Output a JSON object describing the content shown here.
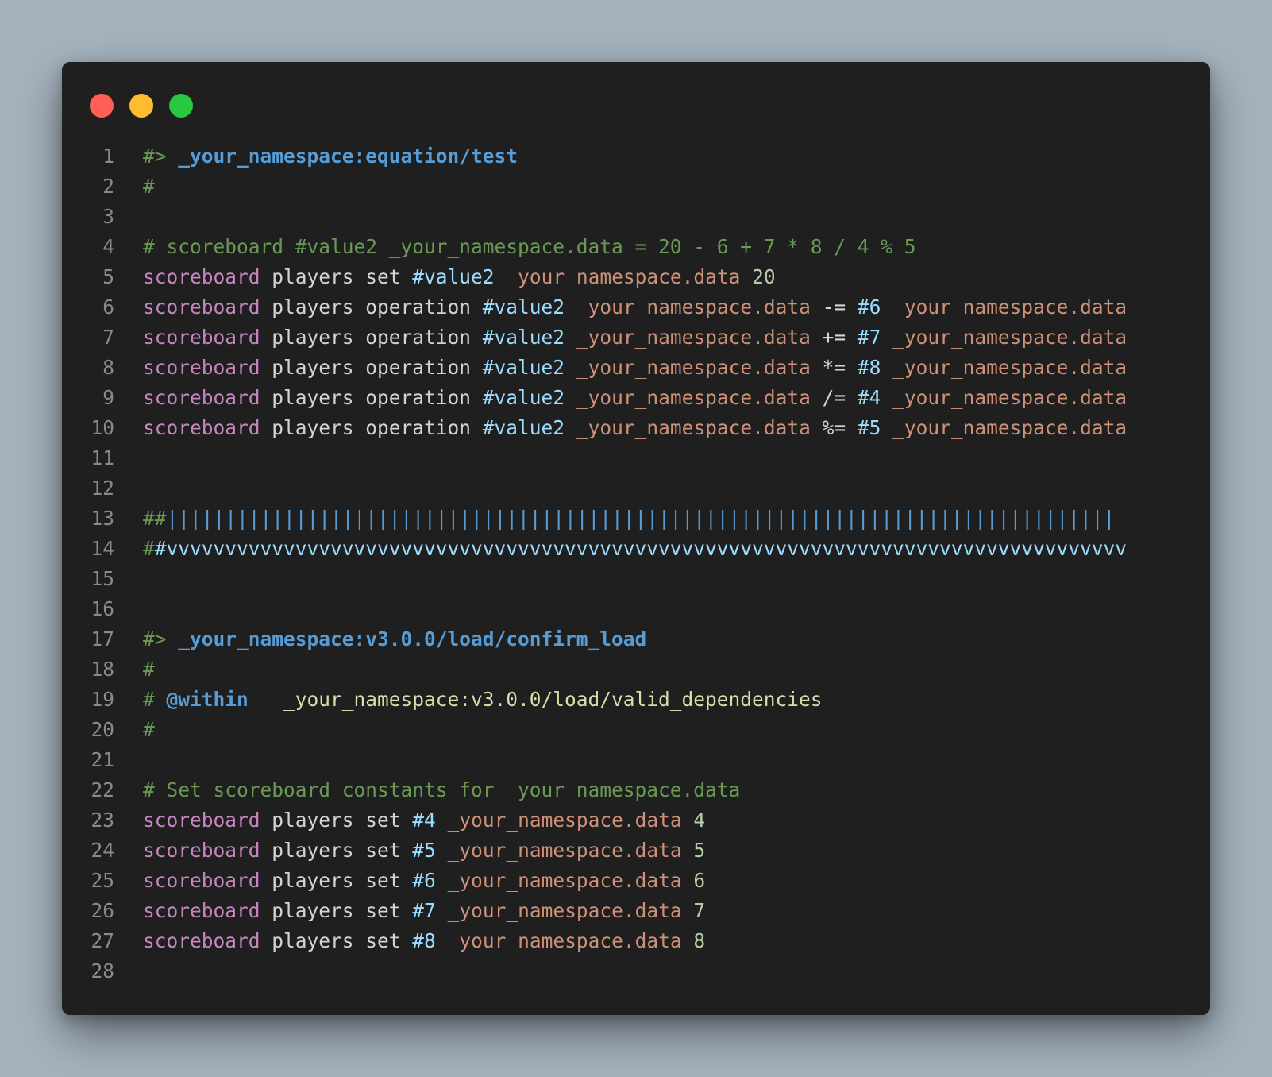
{
  "window": {
    "buttons": [
      "close",
      "minimize",
      "maximize"
    ],
    "colors": {
      "background": "#1f1f1f",
      "page": "#a6b3bf",
      "close": "#ff5f57",
      "minimize": "#febc2e",
      "maximize": "#28c840"
    }
  },
  "code_lines": [
    {
      "n": "1",
      "tokens": [
        [
          "comment",
          "#> "
        ],
        [
          "fn",
          "_your_namespace:equation/test"
        ]
      ]
    },
    {
      "n": "2",
      "tokens": [
        [
          "comment",
          "#"
        ]
      ]
    },
    {
      "n": "3",
      "tokens": []
    },
    {
      "n": "4",
      "tokens": [
        [
          "comment",
          "# scoreboard #value2 _your_namespace.data = 20 - 6 + 7 * 8 / 4 % 5"
        ]
      ]
    },
    {
      "n": "5",
      "tokens": [
        [
          "cmd",
          "scoreboard"
        ],
        [
          "plain",
          " players set "
        ],
        [
          "var",
          "#value2"
        ],
        [
          "plain",
          " "
        ],
        [
          "str",
          "_your_namespace.data"
        ],
        [
          "plain",
          " "
        ],
        [
          "num",
          "20"
        ]
      ]
    },
    {
      "n": "6",
      "tokens": [
        [
          "cmd",
          "scoreboard"
        ],
        [
          "plain",
          " players operation "
        ],
        [
          "var",
          "#value2"
        ],
        [
          "plain",
          " "
        ],
        [
          "str",
          "_your_namespace.data"
        ],
        [
          "plain",
          " -= "
        ],
        [
          "var",
          "#6"
        ],
        [
          "plain",
          " "
        ],
        [
          "str",
          "_your_namespace.data"
        ]
      ]
    },
    {
      "n": "7",
      "tokens": [
        [
          "cmd",
          "scoreboard"
        ],
        [
          "plain",
          " players operation "
        ],
        [
          "var",
          "#value2"
        ],
        [
          "plain",
          " "
        ],
        [
          "str",
          "_your_namespace.data"
        ],
        [
          "plain",
          " += "
        ],
        [
          "var",
          "#7"
        ],
        [
          "plain",
          " "
        ],
        [
          "str",
          "_your_namespace.data"
        ]
      ]
    },
    {
      "n": "8",
      "tokens": [
        [
          "cmd",
          "scoreboard"
        ],
        [
          "plain",
          " players operation "
        ],
        [
          "var",
          "#value2"
        ],
        [
          "plain",
          " "
        ],
        [
          "str",
          "_your_namespace.data"
        ],
        [
          "plain",
          " *= "
        ],
        [
          "var",
          "#8"
        ],
        [
          "plain",
          " "
        ],
        [
          "str",
          "_your_namespace.data"
        ]
      ]
    },
    {
      "n": "9",
      "tokens": [
        [
          "cmd",
          "scoreboard"
        ],
        [
          "plain",
          " players operation "
        ],
        [
          "var",
          "#value2"
        ],
        [
          "plain",
          " "
        ],
        [
          "str",
          "_your_namespace.data"
        ],
        [
          "plain",
          " /= "
        ],
        [
          "var",
          "#4"
        ],
        [
          "plain",
          " "
        ],
        [
          "str",
          "_your_namespace.data"
        ]
      ]
    },
    {
      "n": "10",
      "tokens": [
        [
          "cmd",
          "scoreboard"
        ],
        [
          "plain",
          " players operation "
        ],
        [
          "var",
          "#value2"
        ],
        [
          "plain",
          " "
        ],
        [
          "str",
          "_your_namespace.data"
        ],
        [
          "plain",
          " %= "
        ],
        [
          "var",
          "#5"
        ],
        [
          "plain",
          " "
        ],
        [
          "str",
          "_your_namespace.data"
        ]
      ]
    },
    {
      "n": "11",
      "tokens": []
    },
    {
      "n": "12",
      "tokens": []
    },
    {
      "n": "13",
      "tokens": [
        [
          "comment",
          "##"
        ],
        [
          "bar",
          "|||||||||||||||||||||||||||||||||||||||||||||||||||||||||||||||||||||||||||||||||"
        ]
      ]
    },
    {
      "n": "14",
      "tokens": [
        [
          "comment",
          "#"
        ],
        [
          "v",
          "#vvvvvvvvvvvvvvvvvvvvvvvvvvvvvvvvvvvvvvvvvvvvvvvvvvvvvvvvvvvvvvvvvvvvvvvvvvvvvvvvvv"
        ]
      ]
    },
    {
      "n": "15",
      "tokens": []
    },
    {
      "n": "16",
      "tokens": []
    },
    {
      "n": "17",
      "tokens": [
        [
          "comment",
          "#> "
        ],
        [
          "fn",
          "_your_namespace:v3.0.0/load/confirm_load"
        ]
      ]
    },
    {
      "n": "18",
      "tokens": [
        [
          "comment",
          "#"
        ]
      ]
    },
    {
      "n": "19",
      "tokens": [
        [
          "comment",
          "# "
        ],
        [
          "tag",
          "@within"
        ],
        [
          "plain",
          "   "
        ],
        [
          "path",
          "_your_namespace:v3.0.0/load/valid_dependencies"
        ]
      ]
    },
    {
      "n": "20",
      "tokens": [
        [
          "comment",
          "#"
        ]
      ]
    },
    {
      "n": "21",
      "tokens": []
    },
    {
      "n": "22",
      "tokens": [
        [
          "comment",
          "# Set scoreboard constants for _your_namespace.data"
        ]
      ]
    },
    {
      "n": "23",
      "tokens": [
        [
          "cmd",
          "scoreboard"
        ],
        [
          "plain",
          " players set "
        ],
        [
          "var",
          "#4"
        ],
        [
          "plain",
          " "
        ],
        [
          "str",
          "_your_namespace.data"
        ],
        [
          "plain",
          " "
        ],
        [
          "num",
          "4"
        ]
      ]
    },
    {
      "n": "24",
      "tokens": [
        [
          "cmd",
          "scoreboard"
        ],
        [
          "plain",
          " players set "
        ],
        [
          "var",
          "#5"
        ],
        [
          "plain",
          " "
        ],
        [
          "str",
          "_your_namespace.data"
        ],
        [
          "plain",
          " "
        ],
        [
          "num",
          "5"
        ]
      ]
    },
    {
      "n": "25",
      "tokens": [
        [
          "cmd",
          "scoreboard"
        ],
        [
          "plain",
          " players set "
        ],
        [
          "var",
          "#6"
        ],
        [
          "plain",
          " "
        ],
        [
          "str",
          "_your_namespace.data"
        ],
        [
          "plain",
          " "
        ],
        [
          "num",
          "6"
        ]
      ]
    },
    {
      "n": "26",
      "tokens": [
        [
          "cmd",
          "scoreboard"
        ],
        [
          "plain",
          " players set "
        ],
        [
          "var",
          "#7"
        ],
        [
          "plain",
          " "
        ],
        [
          "str",
          "_your_namespace.data"
        ],
        [
          "plain",
          " "
        ],
        [
          "num",
          "7"
        ]
      ]
    },
    {
      "n": "27",
      "tokens": [
        [
          "cmd",
          "scoreboard"
        ],
        [
          "plain",
          " players set "
        ],
        [
          "var",
          "#8"
        ],
        [
          "plain",
          " "
        ],
        [
          "str",
          "_your_namespace.data"
        ],
        [
          "plain",
          " "
        ],
        [
          "num",
          "8"
        ]
      ]
    },
    {
      "n": "28",
      "tokens": []
    }
  ]
}
